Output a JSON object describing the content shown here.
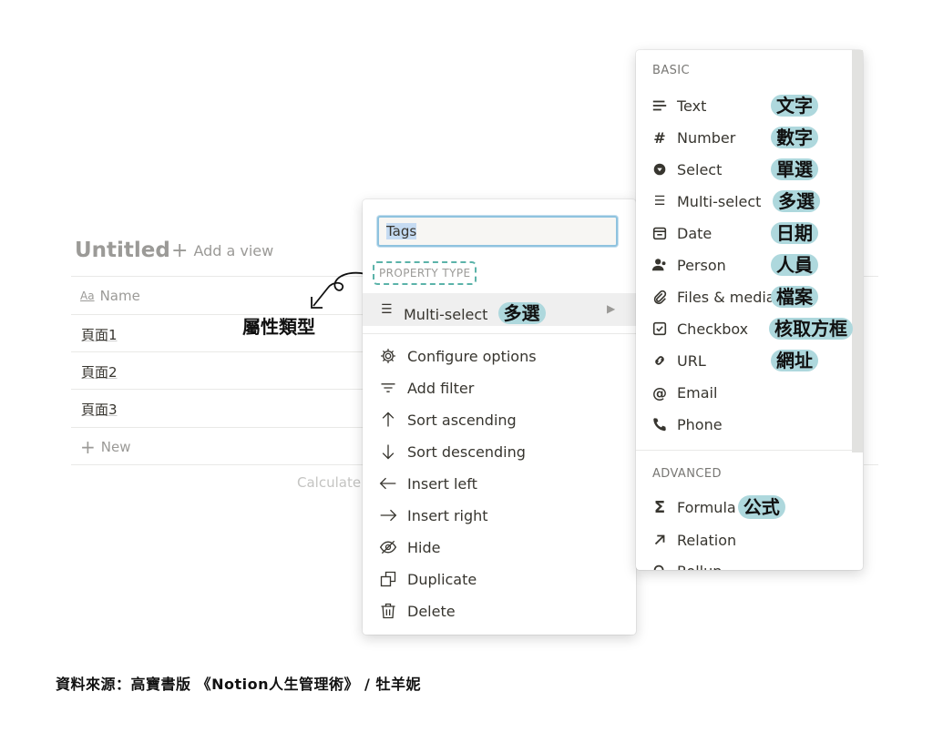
{
  "table": {
    "title": "Untitled",
    "add_view": "Add a view",
    "name_column": "Name",
    "name_icon_text": "Aa",
    "rows": [
      "頁面1",
      "頁面2",
      "頁面3"
    ],
    "new_label": "New",
    "calculate_label": "Calculate"
  },
  "annotation": {
    "label": "屬性類型"
  },
  "property_menu": {
    "name_value": "Tags",
    "section_label": "PROPERTY TYPE",
    "current_type": "Multi-select",
    "current_type_note": "多選",
    "items": [
      {
        "label": "Configure options",
        "icon": "gear-icon"
      },
      {
        "label": "Add filter",
        "icon": "filter-icon"
      },
      {
        "label": "Sort ascending",
        "icon": "arrow-up-icon"
      },
      {
        "label": "Sort descending",
        "icon": "arrow-down-icon"
      },
      {
        "label": "Insert left",
        "icon": "arrow-left-icon"
      },
      {
        "label": "Insert right",
        "icon": "arrow-right-icon"
      },
      {
        "label": "Hide",
        "icon": "eye-slash-icon"
      },
      {
        "label": "Duplicate",
        "icon": "duplicate-icon"
      },
      {
        "label": "Delete",
        "icon": "trash-icon"
      }
    ]
  },
  "type_menu": {
    "basic_label": "BASIC",
    "advanced_label": "ADVANCED",
    "basic_items": [
      {
        "label": "Text",
        "note": "文字",
        "icon": "text-icon"
      },
      {
        "label": "Number",
        "note": "數字",
        "icon": "hash-icon"
      },
      {
        "label": "Select",
        "note": "單選",
        "icon": "select-icon"
      },
      {
        "label": "Multi-select",
        "note": "多選",
        "icon": "list-icon"
      },
      {
        "label": "Date",
        "note": "日期",
        "icon": "calendar-icon"
      },
      {
        "label": "Person",
        "note": "人員",
        "icon": "person-icon"
      },
      {
        "label": "Files & media",
        "note": "檔案",
        "icon": "paperclip-icon"
      },
      {
        "label": "Checkbox",
        "note": "核取方框",
        "icon": "checkbox-icon"
      },
      {
        "label": "URL",
        "note": "網址",
        "icon": "link-icon"
      },
      {
        "label": "Email",
        "note": "",
        "icon": "at-icon"
      },
      {
        "label": "Phone",
        "note": "",
        "icon": "phone-icon"
      }
    ],
    "advanced_items": [
      {
        "label": "Formula",
        "note": "公式",
        "icon": "sigma-icon"
      },
      {
        "label": "Relation",
        "note": "",
        "icon": "arrow-up-right-icon"
      },
      {
        "label": "Rollup",
        "note": "",
        "icon": "search-icon"
      }
    ]
  },
  "footer": {
    "source": "資料來源：高寶書版 《Notion人生管理術》 / 牡羊妮"
  },
  "colors": {
    "highlight": "#aed8dd",
    "dashed_border": "#5bb3a9",
    "input_border": "#8fc3df"
  }
}
